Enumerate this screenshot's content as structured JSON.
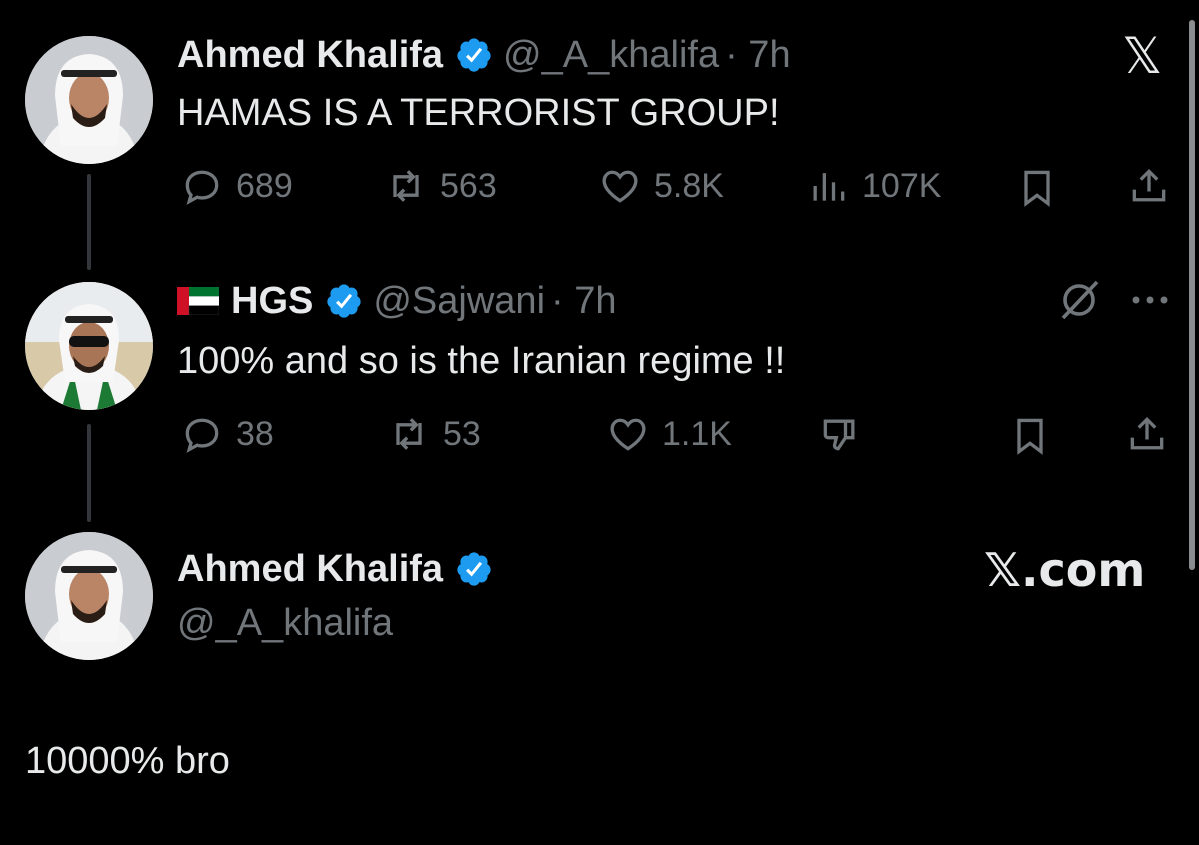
{
  "tweet1": {
    "name": "Ahmed Khalifa",
    "handle": "@_A_khalifa",
    "time": "· 7h",
    "text": "HAMAS IS A TERRORIST GROUP!",
    "replies": "689",
    "reposts": "563",
    "likes": "5.8K",
    "views": "107K"
  },
  "tweet2": {
    "flag": "UAE flag emoji",
    "name": "HGS",
    "handle": "@Sajwani",
    "time": "· 7h",
    "text": "100% and so is the Iranian regime !!",
    "replies": "38",
    "reposts": "53",
    "likes": "1.1K"
  },
  "tweet3": {
    "name": "Ahmed Khalifa",
    "handle": "@_A_khalifa",
    "text": "10000% bro"
  },
  "branding": {
    "logo_small": "𝕏",
    "logo_domain": "𝕏.com"
  },
  "colors": {
    "background": "#000000",
    "text": "#e7e9ea",
    "muted": "#71767b",
    "verified": "#1d9bf0"
  },
  "icons": [
    "reply-icon",
    "repost-icon",
    "like-icon",
    "views-icon",
    "bookmark-icon",
    "share-icon",
    "grok-icon",
    "more-icon",
    "dislike-icon",
    "verified-badge-icon",
    "x-logo-icon"
  ]
}
